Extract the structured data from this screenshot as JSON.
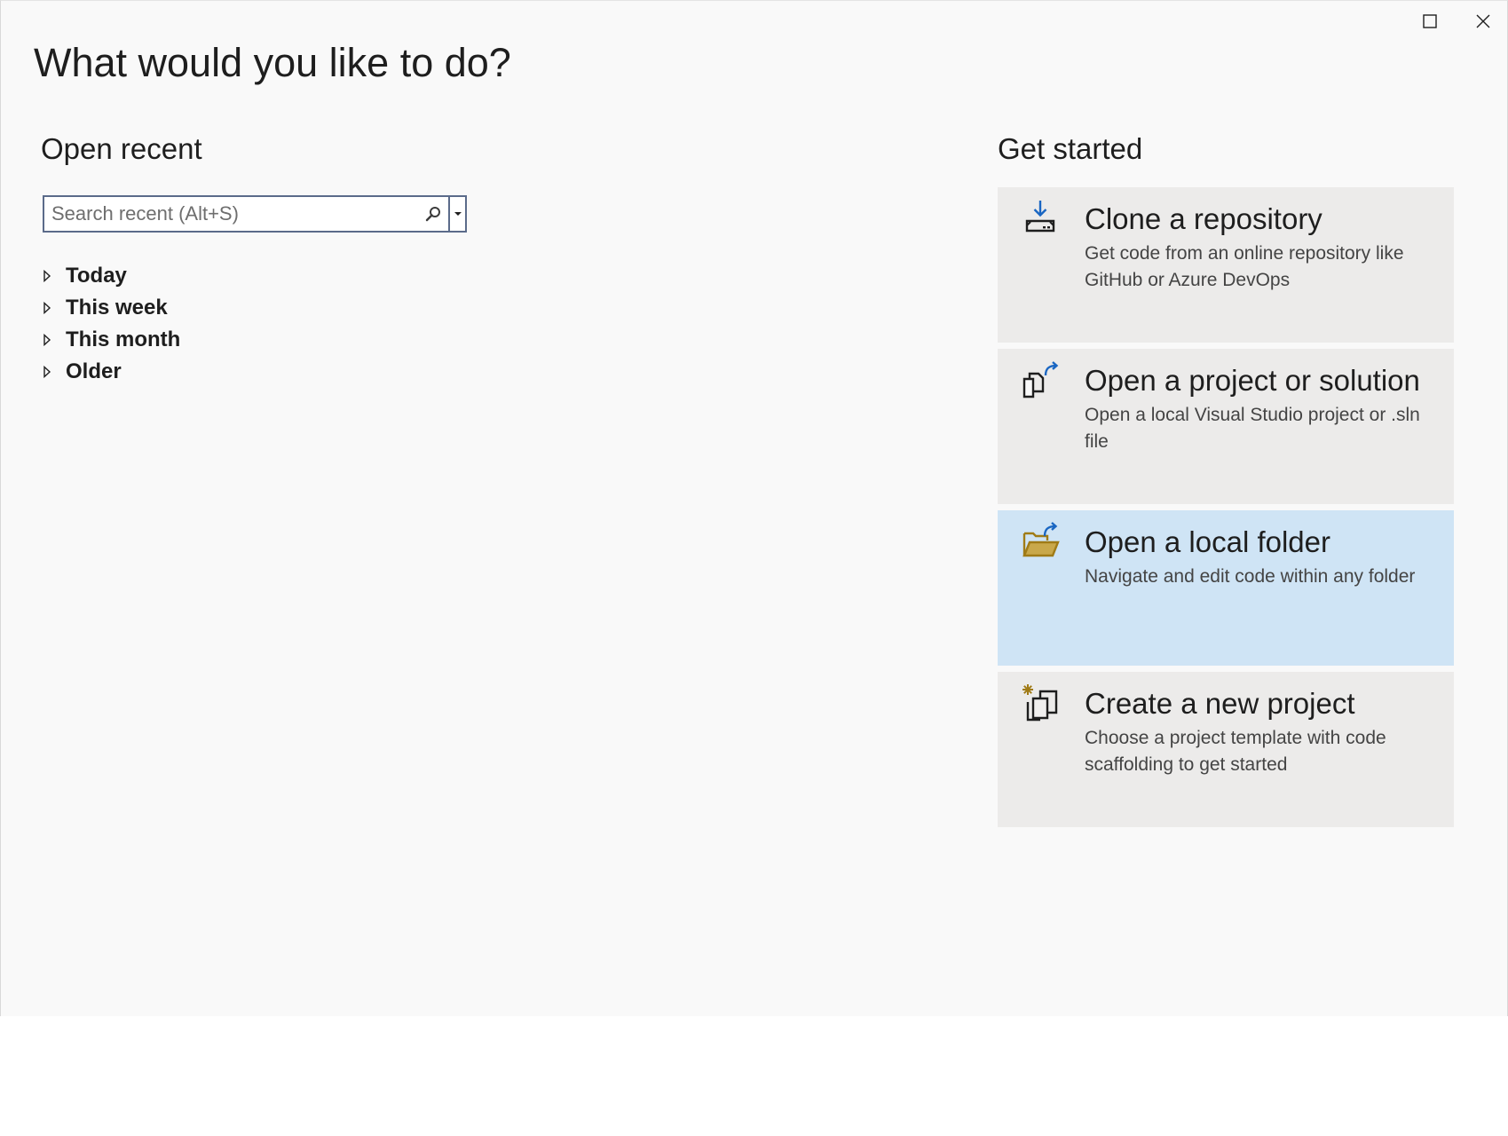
{
  "window": {
    "maximize_icon": "maximize-icon",
    "close_icon": "close-icon"
  },
  "main": {
    "title": "What would you like to do?"
  },
  "open_recent": {
    "title": "Open recent",
    "search": {
      "value": "",
      "placeholder": "Search recent (Alt+S)",
      "icon": "search-icon"
    },
    "groups": [
      {
        "label": "Today"
      },
      {
        "label": "This week"
      },
      {
        "label": "This month"
      },
      {
        "label": "Older"
      }
    ]
  },
  "get_started": {
    "title": "Get started",
    "cards": [
      {
        "title": "Clone a repository",
        "description": "Get code from an online repository like GitHub or Azure DevOps",
        "icon": "clone-repository-icon",
        "selected": false
      },
      {
        "title": "Open a project or solution",
        "description": "Open a local Visual Studio project or .sln file",
        "icon": "open-project-icon",
        "selected": false
      },
      {
        "title": "Open a local folder",
        "description": "Navigate and edit code within any folder",
        "icon": "open-folder-icon",
        "selected": true
      },
      {
        "title": "Create a new project",
        "description": "Choose a project template with code scaffolding to get started",
        "icon": "new-project-icon",
        "selected": false
      }
    ]
  },
  "colors": {
    "accent_blue": "#1a66c2",
    "folder_gold": "#a07b16",
    "selected_card": "#cfe4f5",
    "card_bg": "#ecebea"
  }
}
